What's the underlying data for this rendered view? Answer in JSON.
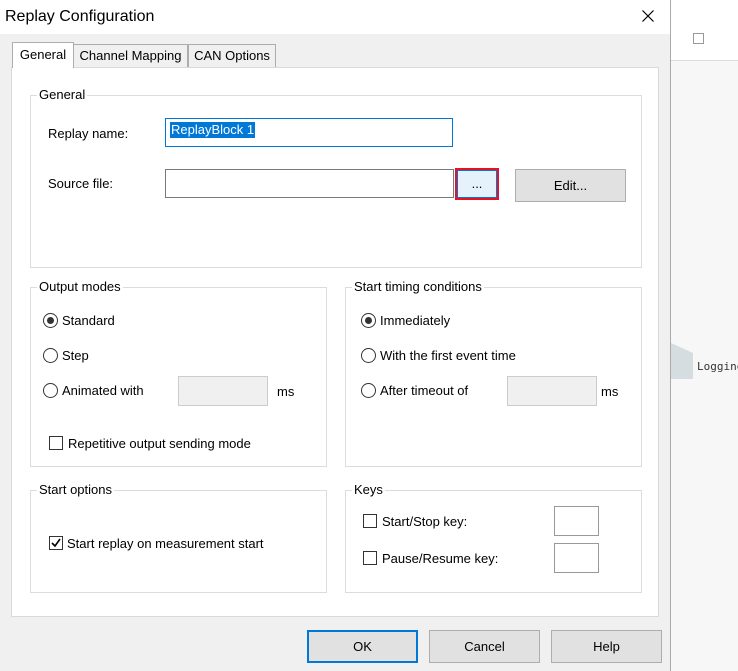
{
  "dialog": {
    "title": "Replay Configuration",
    "tabs": [
      {
        "label": "General",
        "active": true
      },
      {
        "label": "Channel Mapping",
        "active": false
      },
      {
        "label": "CAN Options",
        "active": false
      }
    ]
  },
  "general_group": {
    "title": "General",
    "replay_name_label": "Replay name:",
    "replay_name_value": "ReplayBlock 1",
    "source_file_label": "Source file:",
    "source_file_value": "",
    "browse_label": "...",
    "edit_label": "Edit..."
  },
  "output_modes": {
    "title": "Output modes",
    "standard_label": "Standard",
    "standard_selected": true,
    "step_label": "Step",
    "animated_label": "Animated with",
    "animated_value": "",
    "animated_unit": "ms",
    "repetitive_label": "Repetitive output sending mode",
    "repetitive_checked": false
  },
  "start_timing": {
    "title": "Start timing conditions",
    "immediately_label": "Immediately",
    "immediately_selected": true,
    "first_event_label": "With the first event time",
    "after_timeout_label": "After timeout of",
    "timeout_value": "",
    "timeout_unit": "ms"
  },
  "start_options": {
    "title": "Start options",
    "start_replay_label": "Start replay on measurement start",
    "start_replay_checked": true
  },
  "keys": {
    "title": "Keys",
    "start_stop_label": "Start/Stop key:",
    "start_stop_value": "",
    "pause_resume_label": "Pause/Resume key:",
    "pause_resume_value": ""
  },
  "footer": {
    "ok_label": "OK",
    "cancel_label": "Cancel",
    "help_label": "Help"
  },
  "background_app": {
    "logging_label": "Logging"
  },
  "colors": {
    "accent": "#0078d7",
    "highlight": "#e81123"
  }
}
